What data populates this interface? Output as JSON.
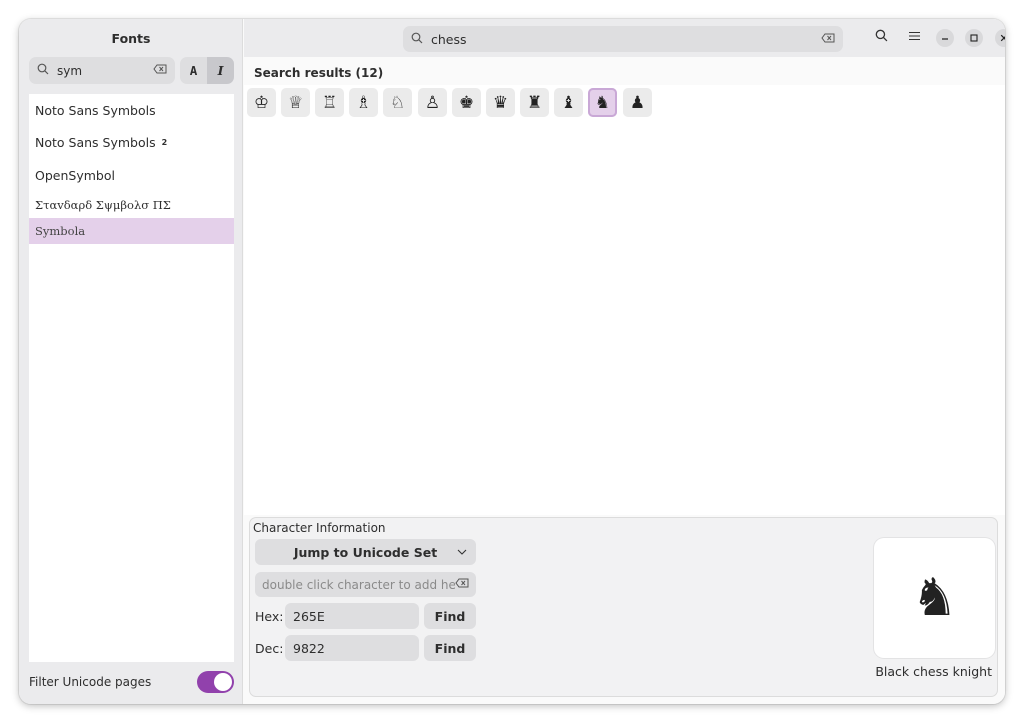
{
  "sidebar": {
    "title": "Fonts",
    "search": {
      "value": "sym"
    },
    "style_toggle": {
      "a_label": "A",
      "i_label": "I"
    },
    "font_list": [
      {
        "label": "Noto Sans Symbols",
        "badge": ""
      },
      {
        "label": "Noto Sans Symbols",
        "badge": "2"
      },
      {
        "label": "OpenSymbol",
        "badge": ""
      },
      {
        "label": "Σταvδαρδ Σψμβολσ ΠΣ",
        "badge": ""
      },
      {
        "label": "Symbola",
        "badge": ""
      }
    ],
    "selected_font": "Symbola",
    "filter_label": "Filter Unicode pages",
    "filter_on": true
  },
  "header": {
    "search_value": "chess"
  },
  "results": {
    "title": "Search results (12)",
    "glyphs": [
      "♔",
      "♕",
      "♖",
      "♗",
      "♘",
      "♙",
      "♚",
      "♛",
      "♜",
      "♝",
      "♞",
      "♟"
    ],
    "selected_index": 10
  },
  "info": {
    "title": "Character Information",
    "jump_label": "Jump to Unicode Set",
    "add_placeholder": "double click character to add he...",
    "hex_label": "Hex:",
    "hex_value": "265E",
    "dec_label": "Dec:",
    "dec_value": "9822",
    "find_label": "Find",
    "preview_glyph": "♞",
    "preview_name": "Black chess knight"
  },
  "colors": {
    "accent": "#9141ac",
    "selection": "#e4d0ea"
  },
  "icons": {
    "search": "search-icon",
    "clear": "clear-text-icon",
    "menu": "hamburger-menu-icon",
    "minimize": "minimize-icon",
    "maximize": "maximize-icon",
    "close": "close-icon",
    "chevron": "chevron-down-icon"
  }
}
